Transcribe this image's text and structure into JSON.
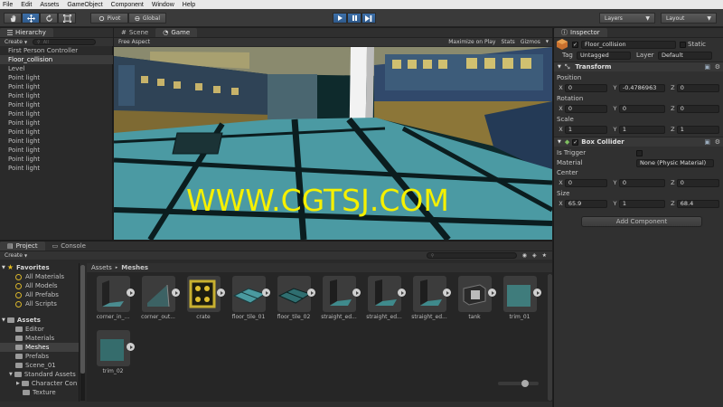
{
  "menu": [
    "File",
    "Edit",
    "Assets",
    "GameObject",
    "Component",
    "Window",
    "Help"
  ],
  "toolbar": {
    "pivot": "Pivot",
    "global": "Global",
    "layers": "Layers",
    "layout": "Layout",
    "tools": [
      "hand-icon",
      "move-icon",
      "rotate-icon",
      "scale-icon"
    ]
  },
  "hierarchy": {
    "tab": "Hierarchy",
    "create": "Create",
    "search_placeholder": "All",
    "items": [
      "First Person Controller",
      "Floor_collision",
      "Level",
      "Point light",
      "Point light",
      "Point light",
      "Point light",
      "Point light",
      "Point light",
      "Point light",
      "Point light",
      "Point light",
      "Point light",
      "Point light"
    ],
    "selected_index": 1
  },
  "scene": {
    "tab_scene": "Scene",
    "tab_game": "Game",
    "aspect": "Free Aspect",
    "maximize": "Maximize on Play",
    "stats": "Stats",
    "gizmos": "Gizmos"
  },
  "watermark": "WWW.CGTSJ.COM",
  "inspector": {
    "tab": "Inspector",
    "object_name": "Floor_collision",
    "static": "Static",
    "tag_label": "Tag",
    "tag_value": "Untagged",
    "layer_label": "Layer",
    "layer_value": "Default",
    "transform": {
      "title": "Transform",
      "position_label": "Position",
      "position": {
        "x": "0",
        "y": "-0.4786963",
        "z": "0"
      },
      "rotation_label": "Rotation",
      "rotation": {
        "x": "0",
        "y": "0",
        "z": "0"
      },
      "scale_label": "Scale",
      "scale": {
        "x": "1",
        "y": "1",
        "z": "1"
      }
    },
    "box_collider": {
      "title": "Box Collider",
      "trigger_label": "Is Trigger",
      "material_label": "Material",
      "material_value": "None (Physic Material)",
      "center_label": "Center",
      "center": {
        "x": "0",
        "y": "0",
        "z": "0"
      },
      "size_label": "Size",
      "size": {
        "x": "65.9",
        "y": "1",
        "z": "68.4"
      }
    },
    "add_component": "Add Component"
  },
  "project": {
    "tab_project": "Project",
    "tab_console": "Console",
    "create": "Create",
    "favorites_title": "Favorites",
    "favorites": [
      "All Materials",
      "All Models",
      "All Prefabs",
      "All Scripts"
    ],
    "assets_title": "Assets",
    "assets_tree": [
      "Editor",
      "Materials",
      "Meshes",
      "Prefabs",
      "Scene_01",
      "Standard Assets",
      "Character Con",
      "Texture"
    ],
    "breadcrumb_root": "Assets",
    "breadcrumb_sep": "▸",
    "breadcrumb_current": "Meshes",
    "assets": [
      "corner_in_...",
      "corner_out...",
      "crate",
      "floor_tile_01",
      "floor_tile_02",
      "straight_ed...",
      "straight_ed...",
      "straight_ed...",
      "tank",
      "trim_01",
      "trim_02"
    ]
  },
  "colors": {
    "accent": "#3d6fa8",
    "watermark": "#f5f000",
    "panel": "#2a2a2a"
  }
}
